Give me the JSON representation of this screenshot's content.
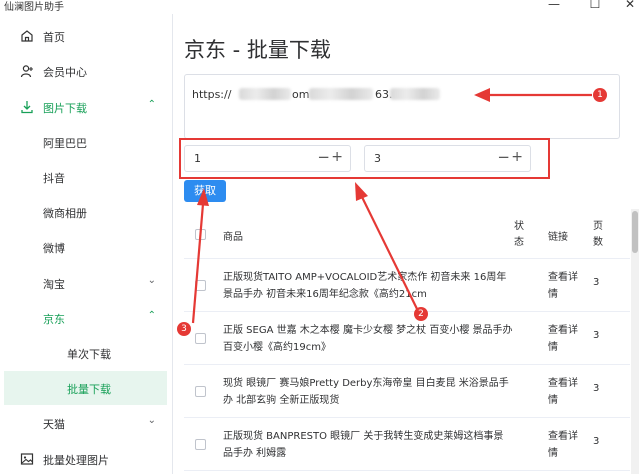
{
  "window": {
    "title": "仙澜图片助手",
    "min_glyph": "—",
    "max_glyph": "☐",
    "close_glyph": "✕"
  },
  "sidebar": {
    "items": [
      {
        "label": "首页",
        "icon": "home-icon"
      },
      {
        "label": "会员中心",
        "icon": "user-add-icon"
      },
      {
        "label": "图片下载",
        "icon": "download-icon",
        "arrow": "⌃"
      },
      {
        "label": "阿里巴巴"
      },
      {
        "label": "抖音"
      },
      {
        "label": "微商相册"
      },
      {
        "label": "微博"
      },
      {
        "label": "淘宝",
        "arrow": "⌄"
      },
      {
        "label": "京东",
        "arrow": "⌃"
      },
      {
        "label": "单次下载"
      },
      {
        "label": "批量下载"
      },
      {
        "label": "天猫",
        "arrow": "⌄"
      },
      {
        "label": "批量处理图片",
        "icon": "image-icon"
      }
    ]
  },
  "main": {
    "title": "京东 - 批量下载",
    "url_prefix": "https://",
    "url_mid": "om",
    "url_mid2": "63.",
    "start_value": "1",
    "end_value": "3",
    "minus_glyph": "−",
    "plus_glyph": "+",
    "fetch_label": "获取"
  },
  "table": {
    "headers": {
      "product": "商品",
      "status": "状态",
      "link": "链接",
      "pages": "页数"
    },
    "rows": [
      {
        "name": "正版现货TAITO AMP+VOCALOID艺术家杰作 初音未来 16周年景品手办 初音未来16周年纪念款《高约21cm",
        "link": "查看详情",
        "pages": "3"
      },
      {
        "name": "正版 SEGA 世嘉 木之本樱 魔卡少女樱 梦之杖 百变小樱 景品手办 百变小樱《高约19cm》",
        "link": "查看详情",
        "pages": "3"
      },
      {
        "name": "现货 眼镜厂 赛马娘Pretty Derby东海帝皇 目白麦昆 米浴景品手办 北部玄驹 全新正版现货",
        "link": "查看详情",
        "pages": "3"
      },
      {
        "name": "正版现货 BANPRESTO 眼镜厂 关于我转生变成史莱姆这档事景品手办 利姆露",
        "link": "查看详情",
        "pages": "3"
      }
    ]
  },
  "annotations": {
    "badge1": "1",
    "badge2": "2",
    "badge3": "3",
    "color": "#e53935"
  },
  "colors": {
    "accent_green": "#18a058",
    "primary_blue": "#2d8cf0",
    "annotation_red": "#e53935"
  }
}
